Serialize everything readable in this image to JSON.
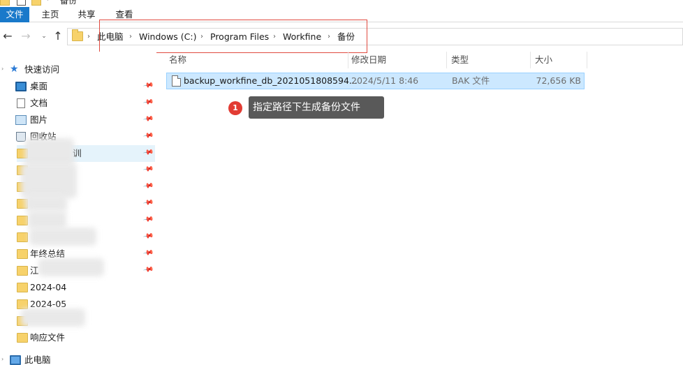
{
  "window": {
    "title": "备份"
  },
  "ribbon": {
    "tabs": [
      "文件",
      "主页",
      "共享",
      "查看"
    ]
  },
  "nav": {
    "back": "←",
    "forward": "→",
    "recent": "⌄",
    "up": "↑"
  },
  "address": {
    "breadcrumbs": [
      "此电脑",
      "Windows (C:)",
      "Program Files",
      "Workfine",
      "备份"
    ],
    "separator": "›"
  },
  "sidebar": {
    "quick_access": "快速访问",
    "items": [
      {
        "label": "桌面",
        "icon": "desktop-icon",
        "pinned": true
      },
      {
        "label": "文档",
        "icon": "document-icon",
        "pinned": true
      },
      {
        "label": "图片",
        "icon": "pictures-icon",
        "pinned": true
      },
      {
        "label": "回收站",
        "icon": "recycle-bin-icon",
        "pinned": true
      },
      {
        "label": "训",
        "icon": "folder-icon",
        "pinned": true,
        "selected": true
      },
      {
        "label": "",
        "icon": "folder-icon",
        "pinned": true
      },
      {
        "label": "",
        "icon": "folder-icon",
        "pinned": true
      },
      {
        "label": "",
        "icon": "folder-icon",
        "pinned": true
      },
      {
        "label": "",
        "icon": "folder-icon",
        "pinned": true
      },
      {
        "label": "",
        "icon": "folder-icon",
        "pinned": true
      },
      {
        "label": "年终总结",
        "icon": "folder-icon",
        "pinned": true
      },
      {
        "label": "江",
        "icon": "folder-icon",
        "pinned": true
      },
      {
        "label": "2024-04",
        "icon": "folder-icon",
        "pinned": false
      },
      {
        "label": "2024-05",
        "icon": "folder-icon",
        "pinned": false
      },
      {
        "label": "",
        "icon": "folder-icon",
        "pinned": false
      },
      {
        "label": "响应文件",
        "icon": "folder-icon",
        "pinned": false
      }
    ],
    "this_pc": "此电脑"
  },
  "columns": {
    "name": "名称",
    "date": "修改日期",
    "type": "类型",
    "size": "大小"
  },
  "files": [
    {
      "name": "backup_workfine_db_2021051808594...",
      "date": "2024/5/11 8:46",
      "type": "BAK 文件",
      "size": "72,656 KB"
    }
  ],
  "annotation": {
    "number": "1",
    "text": "指定路径下生成备份文件"
  },
  "colors": {
    "accent": "#1979ca",
    "selection": "#cce8ff",
    "highlight_box": "#e04a3f",
    "badge": "#e23c34",
    "callout_bg": "#595959"
  }
}
